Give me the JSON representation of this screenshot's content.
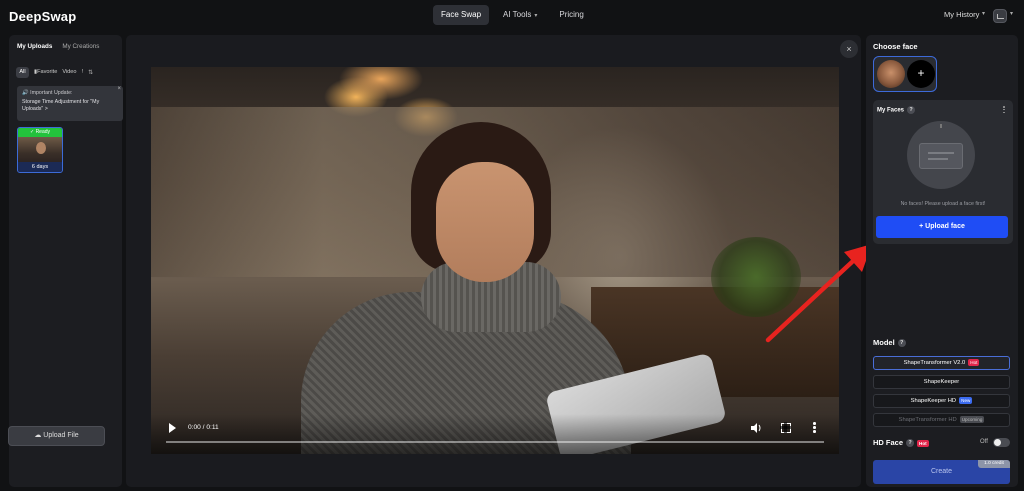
{
  "app": {
    "logo": "DeepSwap"
  },
  "nav": {
    "items": [
      {
        "label": "Face Swap",
        "active": true,
        "dropdown": false
      },
      {
        "label": "AI Tools",
        "active": false,
        "dropdown": true
      },
      {
        "label": "Pricing",
        "active": false,
        "dropdown": false
      }
    ],
    "my_history": "My History"
  },
  "left_panel": {
    "tabs": [
      "My Uploads",
      "My Creations"
    ],
    "filters": {
      "all": "All",
      "favorite": "Favorite",
      "video": "Video",
      "info": "!"
    },
    "notice": {
      "heading": "Important Update:",
      "body": "Storage Time Adjustment for \"My Uploads\" >"
    },
    "upload_item": {
      "status": "Ready",
      "expires": "6 days"
    },
    "upload_button": "Upload File"
  },
  "player": {
    "time": "0:00 / 0:11",
    "progress": 0.0
  },
  "right_panel": {
    "choose_face_title": "Choose face",
    "my_faces": {
      "title": "My Faces",
      "help": "?",
      "empty_message": "No faces! Please upload a face first!",
      "upload_button": "+ Upload face"
    },
    "model": {
      "title": "Model",
      "help": "?",
      "options": [
        {
          "label": "ShapeTransformer V2.0",
          "tag": "Hot",
          "tag_type": "hot",
          "selected": true,
          "disabled": false
        },
        {
          "label": "ShapeKeeper",
          "tag": "",
          "tag_type": "",
          "selected": false,
          "disabled": false
        },
        {
          "label": "ShapeKeeper HD",
          "tag": "New",
          "tag_type": "new",
          "selected": false,
          "disabled": false
        },
        {
          "label": "ShapeTransformer HD",
          "tag": "Upcoming",
          "tag_type": "upcoming",
          "selected": false,
          "disabled": true
        }
      ]
    },
    "hd_face": {
      "title": "HD Face",
      "help": "?",
      "tag": "Hot",
      "state": "Off"
    },
    "create": {
      "label": "Create",
      "credit": "1.0 credit"
    }
  },
  "colors": {
    "accent_blue": "#1f4df5",
    "hot_red": "#e2264b",
    "ready_green": "#23c23c",
    "annotation_arrow": "#e8231f"
  }
}
